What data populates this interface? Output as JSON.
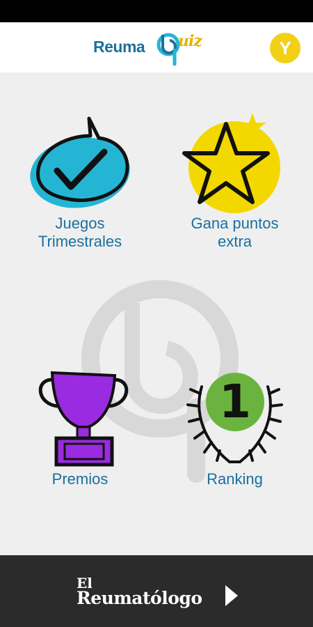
{
  "app": {
    "logo_word": "Reuma",
    "logo_accent": "uiz",
    "avatar_initial": "Y",
    "colors": {
      "primary_text": "#1a6fa0",
      "accent_yellow": "#f2d017",
      "header_bg": "#ffffff",
      "page_bg": "#efefef",
      "footer_bg": "#2b2b2b"
    }
  },
  "menu": [
    {
      "label_line1": "Juegos",
      "label_line2": "Trimestrales",
      "icon": "checkmark-bubble-icon",
      "color": "#25b5d4"
    },
    {
      "label_line1": "Gana puntos",
      "label_line2": "extra",
      "icon": "star-icon",
      "color": "#f3d800"
    },
    {
      "label_line1": "Premios",
      "label_line2": "",
      "icon": "trophy-icon",
      "color": "#9a2be0"
    },
    {
      "label_line1": "Ranking",
      "label_line2": "",
      "icon": "laurel-number-one-icon",
      "color": "#6bb33f",
      "number": "1"
    }
  ],
  "footer": {
    "brand_top": "El",
    "brand_main": "Reumatólogo",
    "icon": "play-arrow-icon"
  }
}
